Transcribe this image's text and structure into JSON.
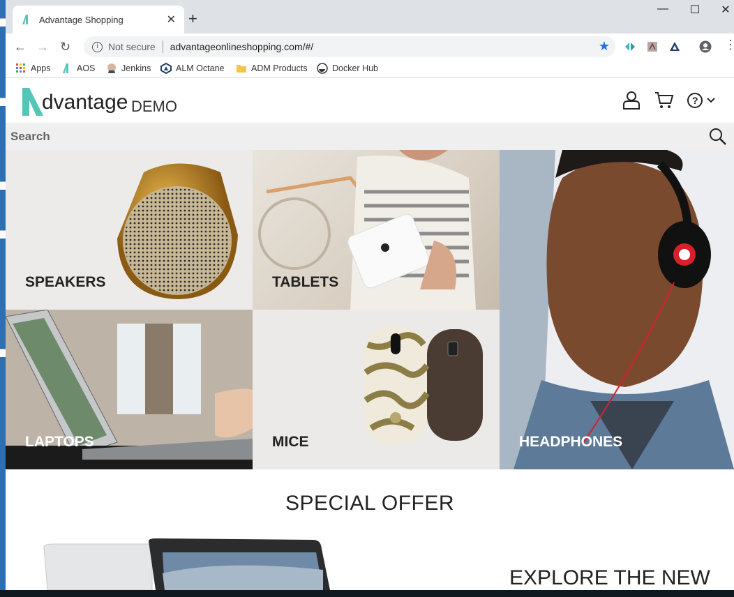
{
  "browser": {
    "tab_title": "Advantage Shopping",
    "tab_close": "✕",
    "new_tab": "+",
    "security_label": "Not secure",
    "url": "advantageonlineshopping.com/#/",
    "window_controls": [
      "—",
      "☐",
      "✕"
    ]
  },
  "bookmarks": [
    {
      "label": "Apps",
      "icon": "apps-grid-icon"
    },
    {
      "label": "AOS",
      "icon": "aos-logo-icon"
    },
    {
      "label": "Jenkins",
      "icon": "jenkins-icon"
    },
    {
      "label": "ALM Octane",
      "icon": "octane-icon"
    },
    {
      "label": "ADM Products",
      "icon": "folder-icon"
    },
    {
      "label": "Docker Hub",
      "icon": "docker-icon"
    }
  ],
  "site": {
    "logo_main": "dvantage",
    "logo_demo": "DEMO",
    "search_placeholder": "Search",
    "brand_color": "#55c5b7"
  },
  "categories": [
    {
      "label": "SPEAKERS"
    },
    {
      "label": "TABLETS"
    },
    {
      "label": "HEADPHONES"
    },
    {
      "label": "LAPTOPS"
    },
    {
      "label": "MICE"
    }
  ],
  "special_offer": {
    "heading": "SPECIAL OFFER",
    "explore": "EXPLORE THE NEW"
  }
}
